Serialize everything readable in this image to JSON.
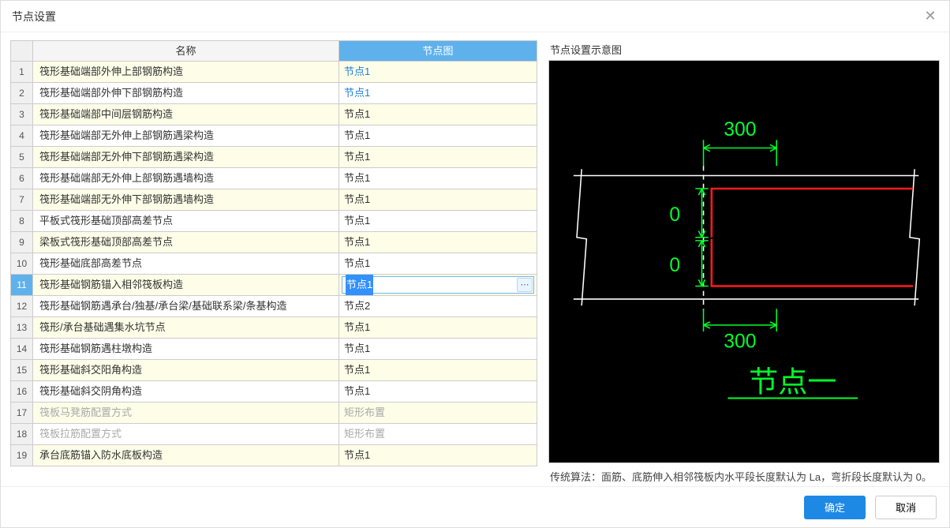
{
  "dialog": {
    "title": "节点设置"
  },
  "table": {
    "headers": {
      "name": "名称",
      "node": "节点图"
    },
    "rows": [
      {
        "num": "1",
        "name": "筏形基础端部外伸上部钢筋构造",
        "node": "节点1",
        "linked": true
      },
      {
        "num": "2",
        "name": "筏形基础端部外伸下部钢筋构造",
        "node": "节点1",
        "linked": true
      },
      {
        "num": "3",
        "name": "筏形基础端部中间层钢筋构造",
        "node": "节点1"
      },
      {
        "num": "4",
        "name": "筏形基础端部无外伸上部钢筋遇梁构造",
        "node": "节点1"
      },
      {
        "num": "5",
        "name": "筏形基础端部无外伸下部钢筋遇梁构造",
        "node": "节点1"
      },
      {
        "num": "6",
        "name": "筏形基础端部无外伸上部钢筋遇墙构造",
        "node": "节点1"
      },
      {
        "num": "7",
        "name": "筏形基础端部无外伸下部钢筋遇墙构造",
        "node": "节点1"
      },
      {
        "num": "8",
        "name": "平板式筏形基础顶部高差节点",
        "node": "节点1"
      },
      {
        "num": "9",
        "name": "梁板式筏形基础顶部高差节点",
        "node": "节点1"
      },
      {
        "num": "10",
        "name": "筏形基础底部高差节点",
        "node": "节点1"
      },
      {
        "num": "11",
        "name": "筏形基础钢筋锚入相邻筏板构造",
        "node": "节点1",
        "editing": true
      },
      {
        "num": "12",
        "name": "筏形基础钢筋遇承台/独基/承台梁/基础联系梁/条基构造",
        "node": "节点2"
      },
      {
        "num": "13",
        "name": "筏形/承台基础遇集水坑节点",
        "node": "节点1"
      },
      {
        "num": "14",
        "name": "筏形基础钢筋遇柱墩构造",
        "node": "节点1"
      },
      {
        "num": "15",
        "name": "筏形基础斜交阳角构造",
        "node": "节点1"
      },
      {
        "num": "16",
        "name": "筏形基础斜交阴角构造",
        "node": "节点1"
      },
      {
        "num": "17",
        "name": "筏板马凳筋配置方式",
        "node": "矩形布置",
        "disabled": true
      },
      {
        "num": "18",
        "name": "筏板拉筋配置方式",
        "node": "矩形布置",
        "disabled": true
      },
      {
        "num": "19",
        "name": "承台底筋锚入防水底板构造",
        "node": "节点1"
      }
    ]
  },
  "preview": {
    "label": "节点设置示意图",
    "diagram": {
      "title": "节点一",
      "dim_top": "300",
      "dim_bottom": "300",
      "value_upper": "0",
      "value_lower": "0"
    },
    "description": "传统算法：面筋、底筋伸入相邻筏板内水平段长度默认为 La，弯折段长度默认为 0。"
  },
  "footer": {
    "ok": "确定",
    "cancel": "取消"
  },
  "misc": {
    "ellipsis": "⋯"
  }
}
